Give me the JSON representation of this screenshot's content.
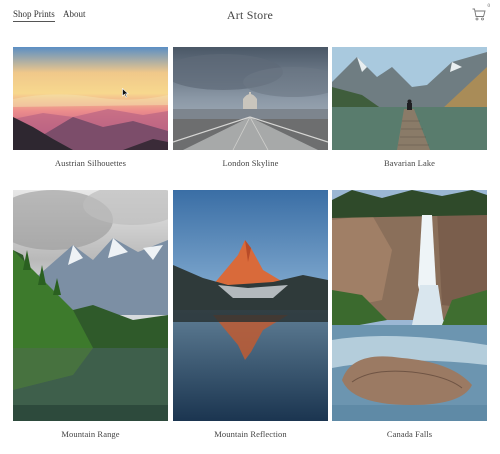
{
  "nav": {
    "shop_label": "Shop Prints",
    "about_label": "About"
  },
  "brand": {
    "title": "Art Store"
  },
  "cart": {
    "icon": "cart-icon",
    "count": "0"
  },
  "products": [
    {
      "title": "Austrian Silhouettes"
    },
    {
      "title": "London Skyline"
    },
    {
      "title": "Bavarian Lake"
    },
    {
      "title": "Mountain Range"
    },
    {
      "title": "Mountain Reflection"
    },
    {
      "title": "Canada Falls"
    }
  ]
}
